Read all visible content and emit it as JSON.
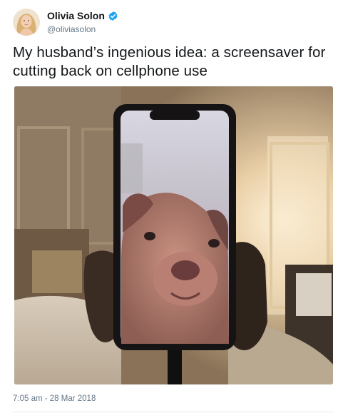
{
  "author": {
    "display_name": "Olivia Solon",
    "handle": "@oliviasolon",
    "verified": true
  },
  "tweet": {
    "text": "My husband’s ingenious idea: a screensaver for cutting back on cellphone use",
    "timestamp": "7:05 am - 28 Mar 2018"
  },
  "colors": {
    "verified_badge": "#1da1f2",
    "secondary_text": "#657786",
    "primary_text": "#14171a"
  },
  "icons": {
    "verified": "verified-badge-icon"
  }
}
